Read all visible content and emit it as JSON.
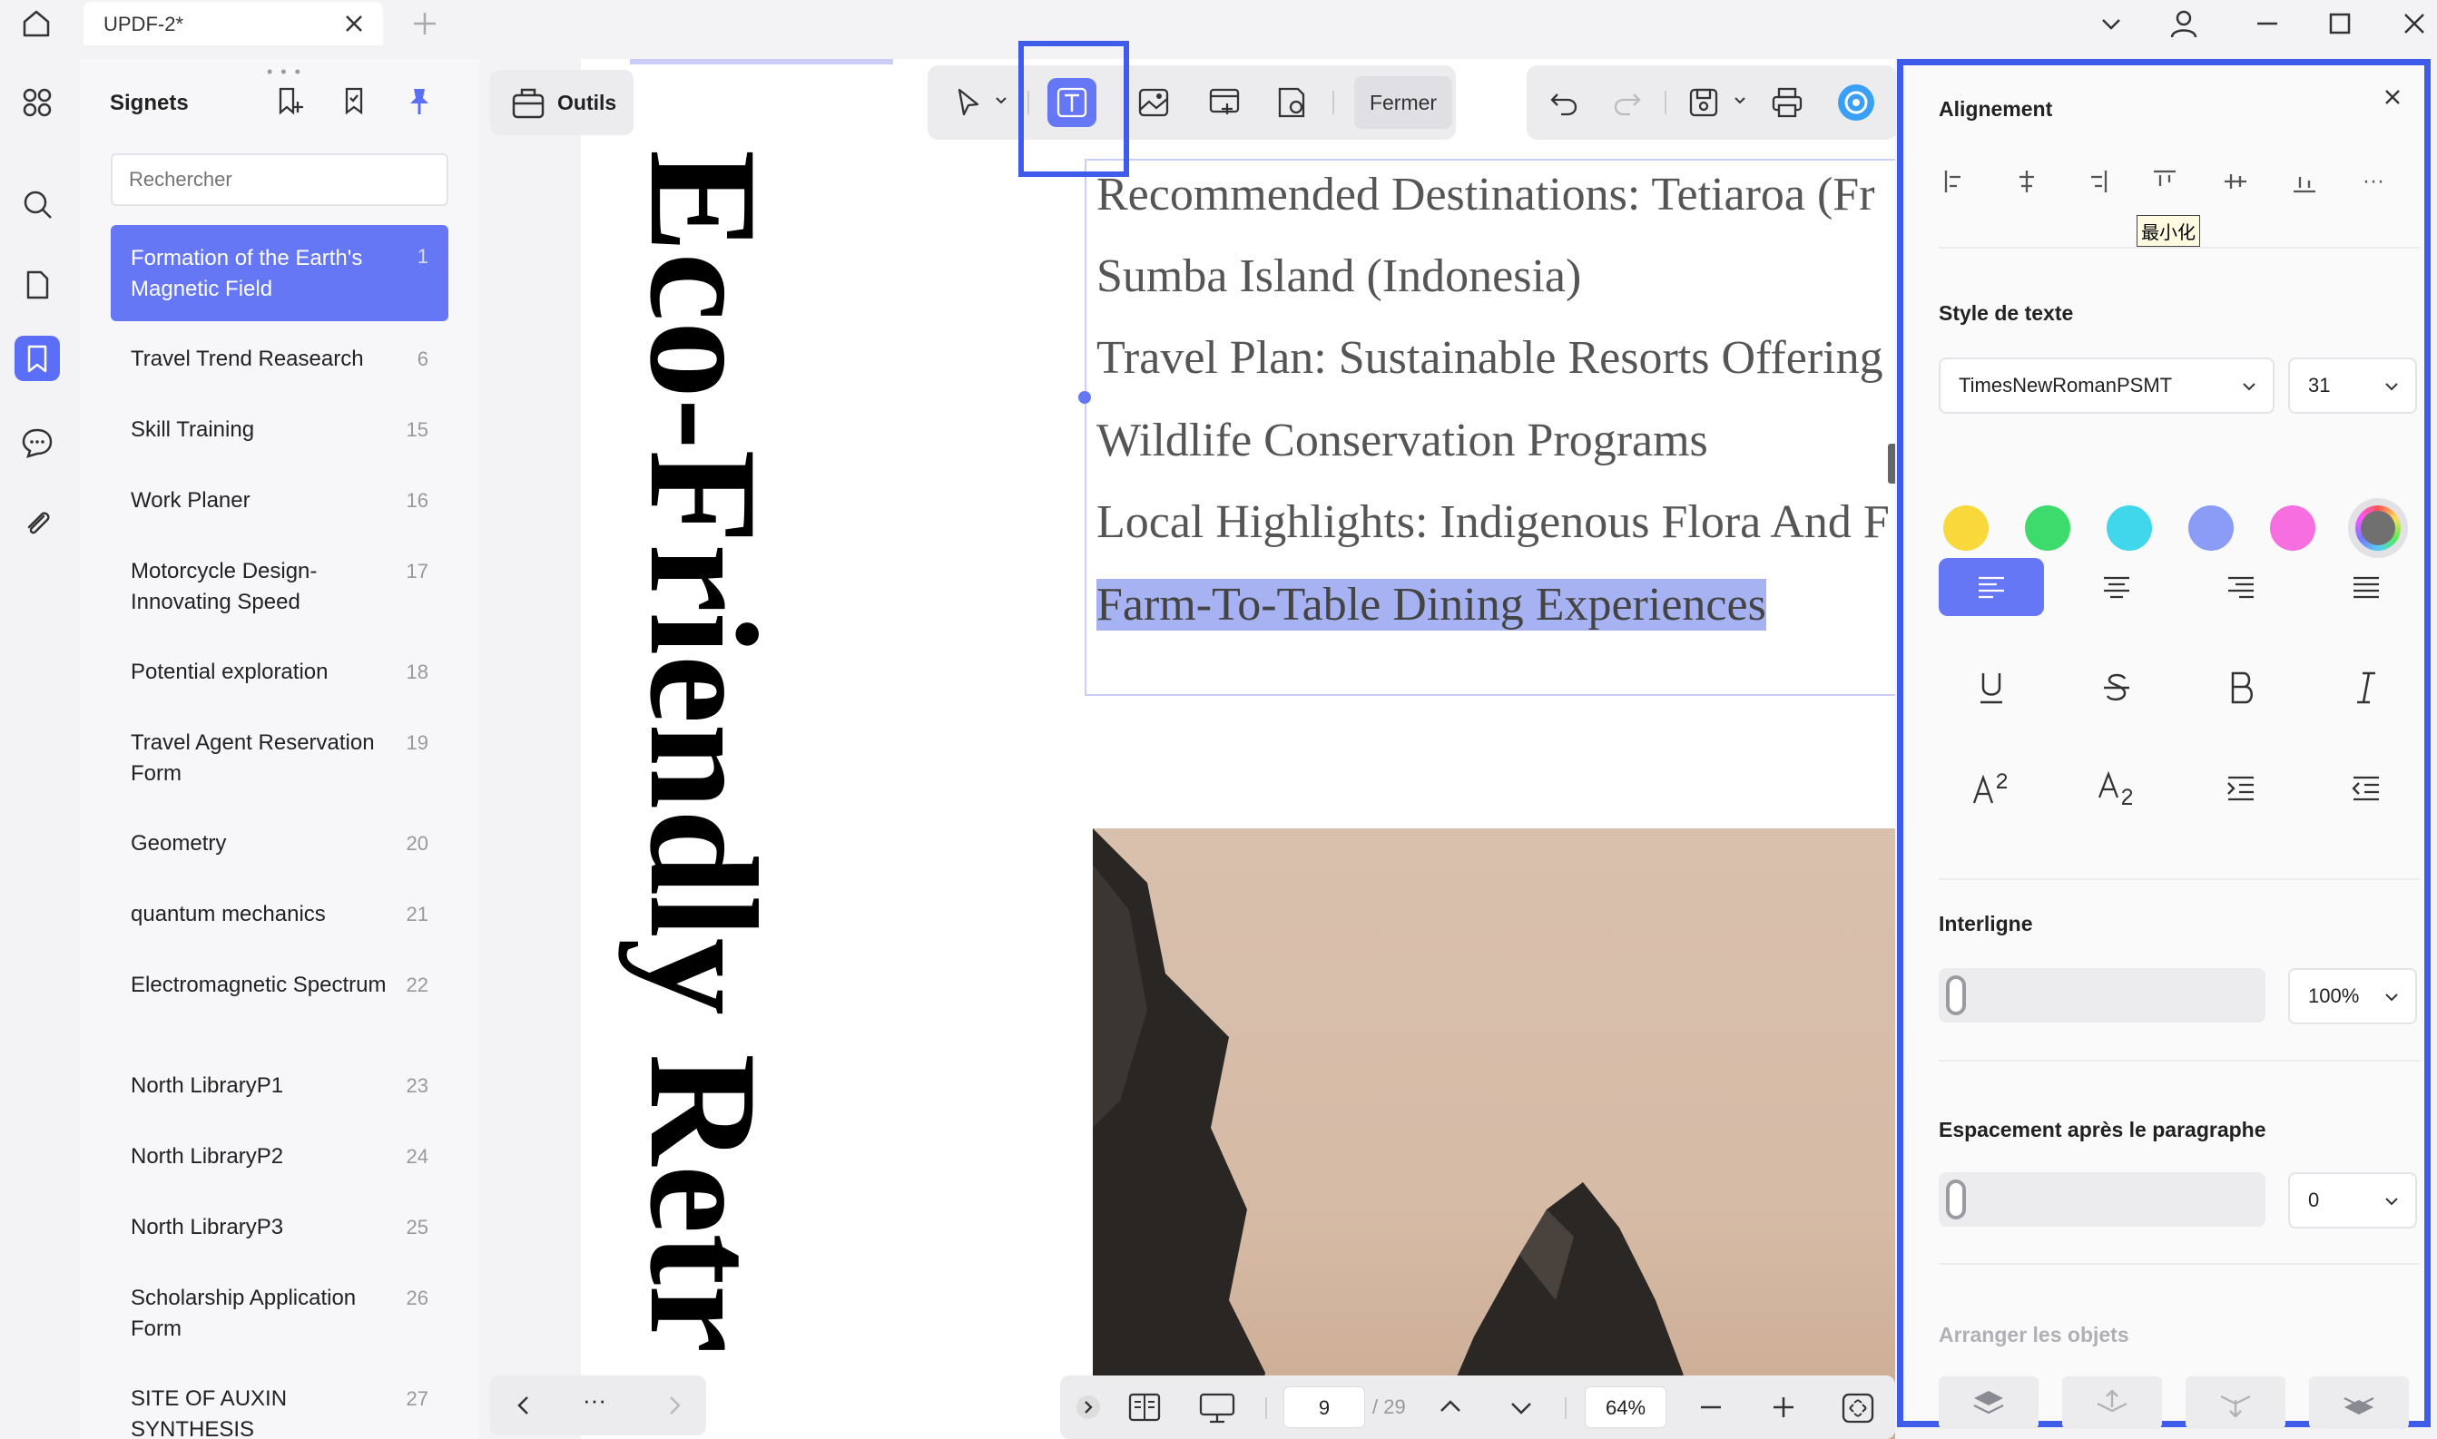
{
  "tab": {
    "title": "UPDF-2*"
  },
  "bookmarks": {
    "title": "Signets",
    "search_placeholder": "Rechercher",
    "items": [
      {
        "label": "Formation of the Earth's Magnetic Field",
        "page": "1",
        "selected": true
      },
      {
        "label": "Travel Trend Reasearch",
        "page": "6"
      },
      {
        "label": "Skill Training",
        "page": "15"
      },
      {
        "label": "Work Planer",
        "page": "16"
      },
      {
        "label": "Motorcycle Design-Innovating Speed",
        "page": "17"
      },
      {
        "label": "Potential exploration",
        "page": "18"
      },
      {
        "label": "Travel Agent Reservation Form",
        "page": "19"
      },
      {
        "label": "Geometry",
        "page": "20"
      },
      {
        "label": "quantum mechanics",
        "page": "21"
      },
      {
        "label": "Electromagnetic Spectrum",
        "page": "22"
      },
      {
        "label": "North LibraryP1",
        "page": "23"
      },
      {
        "label": "North LibraryP2",
        "page": "24"
      },
      {
        "label": "North LibraryP3",
        "page": "25"
      },
      {
        "label": "Scholarship Application Form",
        "page": "26"
      },
      {
        "label": "SITE OF AUXIN SYNTHESIS",
        "page": "27"
      }
    ]
  },
  "tools": {
    "label": "Outils"
  },
  "toolbar": {
    "close_label": "Fermer"
  },
  "document": {
    "vertical_title": "Eco-Friendly Retr",
    "lines": [
      "Recommended Destinations: Tetiaroa (Fr",
      "Sumba Island (Indonesia)",
      "Travel Plan: Sustainable Resorts Offering",
      "Wildlife Conservation Programs",
      "Local Highlights: Indigenous Flora And F",
      "Farm-To-Table Dining Experiences"
    ]
  },
  "navigation": {
    "page_current": "9",
    "page_total": "/ 29",
    "zoom": "64%"
  },
  "properties": {
    "alignment_title": "Alignement",
    "tooltip": "最小化",
    "text_style_title": "Style de texte",
    "font_family": "TimesNewRomanPSMT",
    "font_size": "31",
    "colors": [
      "#f9d83c",
      "#3ddb6b",
      "#40d6ec",
      "#8b9cf6",
      "#f66ee0",
      "#707070"
    ],
    "line_spacing_title": "Interligne",
    "line_spacing_value": "100%",
    "paragraph_spacing_title": "Espacement après le paragraphe",
    "paragraph_spacing_value": "0",
    "arrange_title": "Arranger les objets"
  },
  "accent_color": "#5b6ef7"
}
